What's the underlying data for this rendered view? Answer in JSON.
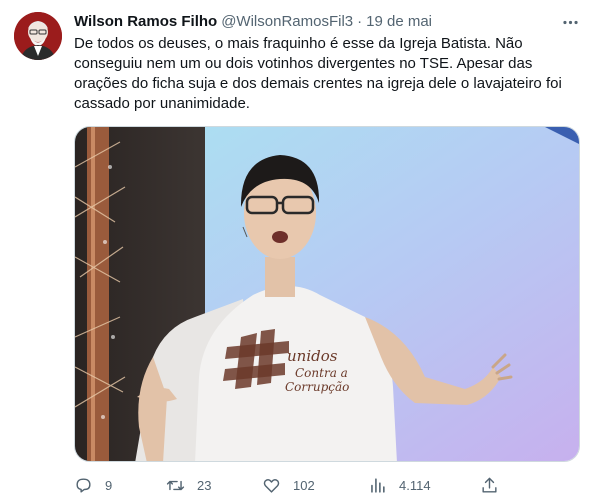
{
  "tweet": {
    "author_name": "Wilson Ramos Filho",
    "handle": "@WilsonRamosFil3",
    "separator": "·",
    "date": "19 de mai",
    "text": "De todos os deuses, o mais fraquinho é esse da Igreja Batista. Não\nconseguiu nem um ou dois votinhos divergentes no TSE. Apesar das\norações do ficha suja e dos demais crentes na igreja dele o lavajateiro foi\ncassado por unanimidade.",
    "shirt_text": "Unidos Contra a Corrupção"
  },
  "actions": {
    "replies": "9",
    "retweets": "23",
    "likes": "102",
    "views": "4.114"
  },
  "icons": {
    "more": "more-dots-icon",
    "reply": "reply-icon",
    "retweet": "retweet-icon",
    "like": "heart-icon",
    "views": "views-chart-icon",
    "share": "share-icon"
  },
  "colors": {
    "text": "#0f1419",
    "secondary": "#536471",
    "border": "#cfd9de",
    "avatar_bg": "#a52a2a"
  }
}
